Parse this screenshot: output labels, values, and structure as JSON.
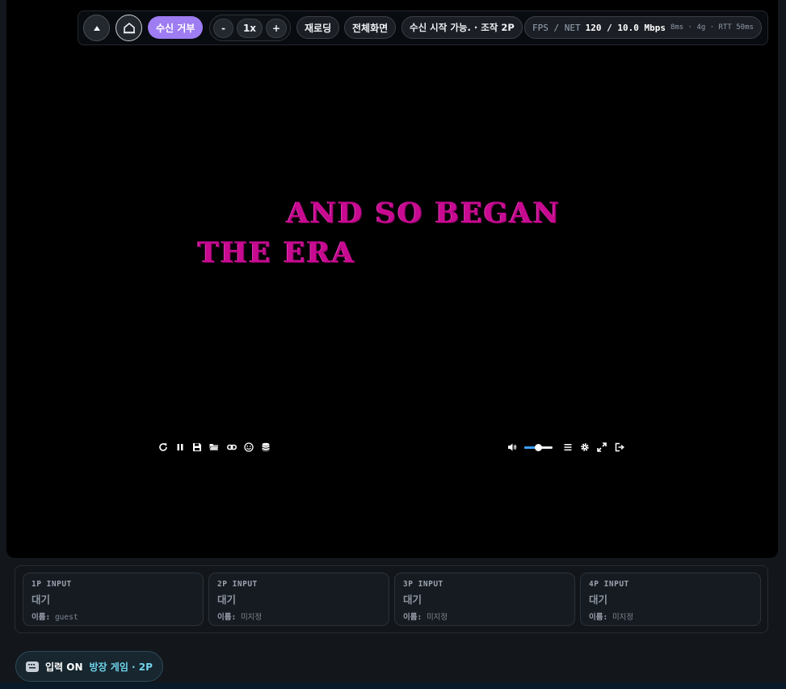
{
  "toolbar": {
    "collapse_icon": "caret-up-icon",
    "home_icon": "home-icon",
    "reject_label": "수신 거부",
    "speed": {
      "minus": "-",
      "value": "1x",
      "plus": "+"
    },
    "reload_label": "재로딩",
    "fullscreen_label": "전체화면",
    "status_label": "수신 시작 가능. · 조작 2P",
    "net": {
      "label": "FPS / NET",
      "value": "120 / 10.0 Mbps",
      "meta": "8ms · 4g · RTT 50ms"
    }
  },
  "game": {
    "line1": "AND SO BEGAN",
    "line2": "THE ERA",
    "text_color": "#c80a91",
    "left_controls": [
      "restart-icon",
      "pause-icon",
      "save-icon",
      "folder-icon",
      "link-icon",
      "smiley-icon",
      "database-icon"
    ],
    "right_controls": [
      "volume-icon",
      "menu-icon",
      "gear-icon",
      "expand-icon",
      "exit-icon"
    ],
    "volume_level": 0.5
  },
  "inputs": [
    {
      "label": "1P INPUT",
      "status": "대기",
      "name_label": "이름:",
      "name_value": "guest"
    },
    {
      "label": "2P INPUT",
      "status": "대기",
      "name_label": "이름:",
      "name_value": "미지정"
    },
    {
      "label": "3P INPUT",
      "status": "대기",
      "name_label": "이름:",
      "name_value": "미지정"
    },
    {
      "label": "4P INPUT",
      "status": "대기",
      "name_label": "이름:",
      "name_value": "미지정"
    }
  ],
  "input_badge": {
    "icon": "keyboard-icon",
    "state": "입력 ON",
    "room": "방장 게임 · 2P"
  },
  "colors": {
    "accent": "#9e7cf2",
    "room": "#6fd3ea",
    "volume": "#3aa0ff"
  }
}
